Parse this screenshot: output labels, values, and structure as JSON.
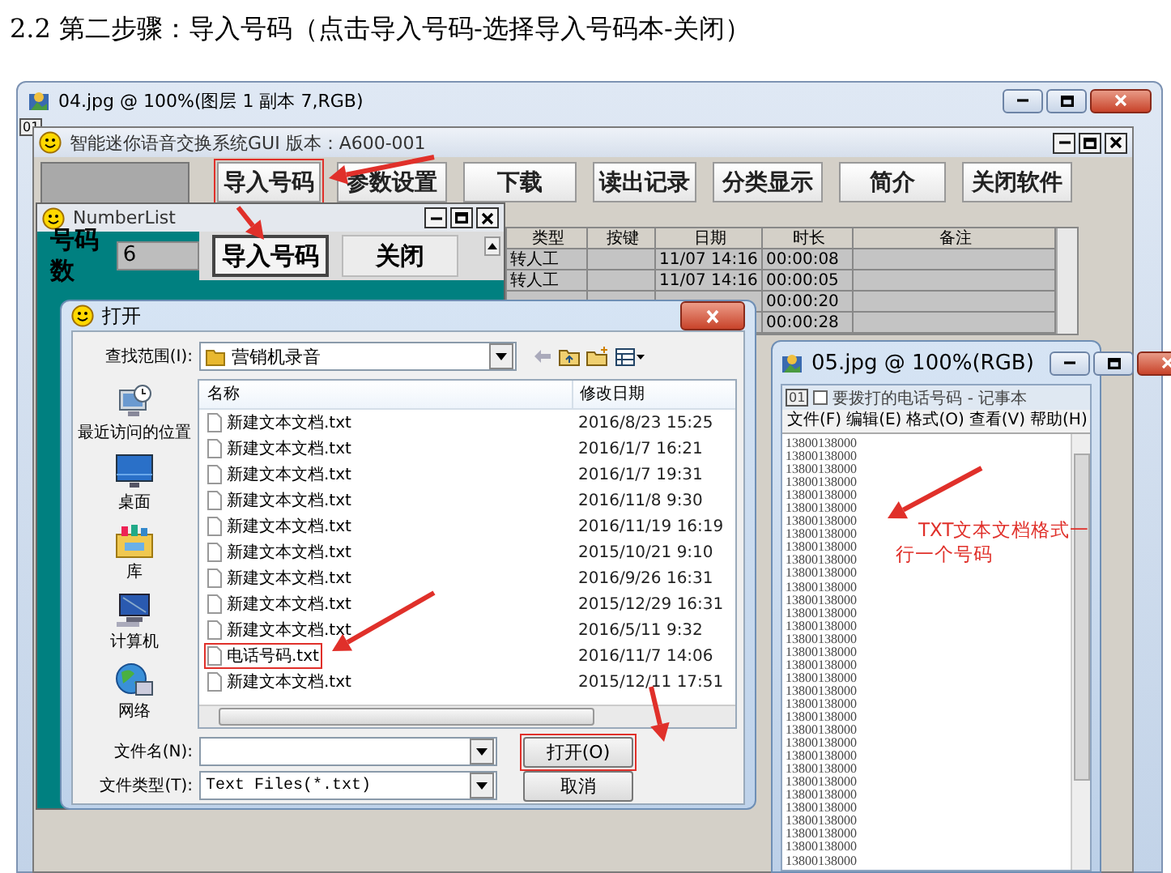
{
  "heading": "2.2 第二步骤：导入号码（点击导入号码-选择导入号码本-关闭）",
  "outer_window": {
    "title": "04.jpg @ 100%(图层 1 副本 7,RGB)",
    "badge": "01"
  },
  "app_window": {
    "title": "智能迷你语音交换系统GUI 版本：A600-001",
    "toolbar": [
      {
        "label": "导入号码",
        "highlighted": true
      },
      {
        "label": "参数设置",
        "highlighted": false
      },
      {
        "label": "下载",
        "highlighted": false
      },
      {
        "label": "读出记录",
        "highlighted": false
      },
      {
        "label": "分类显示",
        "highlighted": false
      },
      {
        "label": "简介",
        "highlighted": false
      },
      {
        "label": "关闭软件",
        "highlighted": false
      }
    ],
    "table": {
      "columns": [
        "类型",
        "按键",
        "日期",
        "时长",
        "备注"
      ],
      "rows": [
        {
          "type": "转人工",
          "date": "11/07 14:16",
          "duration": "00:00:08"
        },
        {
          "type": "转人工",
          "date": "11/07 14:16",
          "duration": "00:00:05"
        },
        {
          "duration": "00:00:20"
        },
        {
          "duration": "00:00:28"
        }
      ]
    }
  },
  "number_list": {
    "title": "NumberList",
    "count_label": "号码数",
    "count_value": "6",
    "buttons": [
      {
        "label": "导入号码",
        "focused": true
      },
      {
        "label": "关闭",
        "focused": false
      }
    ]
  },
  "open_dialog": {
    "title": "打开",
    "look_in_label": "查找范围(I):",
    "look_in_value": "营销机录音",
    "places": [
      {
        "label": "最近访问的位置",
        "kind": "recent"
      },
      {
        "label": "桌面",
        "kind": "desktop"
      },
      {
        "label": "库",
        "kind": "library"
      },
      {
        "label": "计算机",
        "kind": "computer"
      },
      {
        "label": "网络",
        "kind": "network"
      }
    ],
    "columns": [
      "名称",
      "修改日期"
    ],
    "files": [
      {
        "name": "新建文本文档.txt",
        "date": "2016/8/23 15:25",
        "highlighted": false
      },
      {
        "name": "新建文本文档.txt",
        "date": "2016/1/7 16:21",
        "highlighted": false
      },
      {
        "name": "新建文本文档.txt",
        "date": "2016/1/7 19:31",
        "highlighted": false
      },
      {
        "name": "新建文本文档.txt",
        "date": "2016/11/8 9:30",
        "highlighted": false
      },
      {
        "name": "新建文本文档.txt",
        "date": "2016/11/19 16:19",
        "highlighted": false
      },
      {
        "name": "新建文本文档.txt",
        "date": "2015/10/21 9:10",
        "highlighted": false
      },
      {
        "name": "新建文本文档.txt",
        "date": "2016/9/26 16:31",
        "highlighted": false
      },
      {
        "name": "新建文本文档.txt",
        "date": "2015/12/29 16:31",
        "highlighted": false
      },
      {
        "name": "新建文本文档.txt",
        "date": "2016/5/11 9:32",
        "highlighted": false
      },
      {
        "name": "电话号码.txt",
        "date": "2016/11/7 14:06",
        "highlighted": true
      },
      {
        "name": "新建文本文档.txt",
        "date": "2015/12/11 17:51",
        "highlighted": false
      }
    ],
    "filename_label": "文件名(N):",
    "filetype_label": "文件类型(T):",
    "filetype_value": "Text Files(*.txt)",
    "buttons": [
      {
        "label": "打开(O)",
        "highlighted": true
      },
      {
        "label": "取消",
        "highlighted": false
      }
    ]
  },
  "notepad": {
    "outer_title": "05.jpg @ 100%(RGB)",
    "badge": "01",
    "title": "要拨打的电话号码 - 记事本",
    "menu": [
      "文件(F)",
      "编辑(E)",
      "格式(O)",
      "查看(V)",
      "帮助(H)"
    ],
    "lines": [
      "13800138000",
      "13800138000",
      "13800138000",
      "13800138000",
      "13800138000",
      "13800138000",
      "13800138000",
      "13800138000",
      "13800138000",
      "13800138000",
      "13800138000",
      "13800138000",
      "13800138000",
      "13800138000",
      "13800138000",
      "13800138000",
      "13800138000",
      "13800138000",
      "13800138000",
      "13800138000",
      "13800138000",
      "13800138000",
      "13800138000",
      "13800138000",
      "13800138000",
      "13800138000",
      "13800138000",
      "13800138000",
      "13800138000",
      "13800138000",
      "13800138000",
      "13800138000",
      "13800138000"
    ],
    "note": "TXT文本文档格式一行一个号码"
  }
}
